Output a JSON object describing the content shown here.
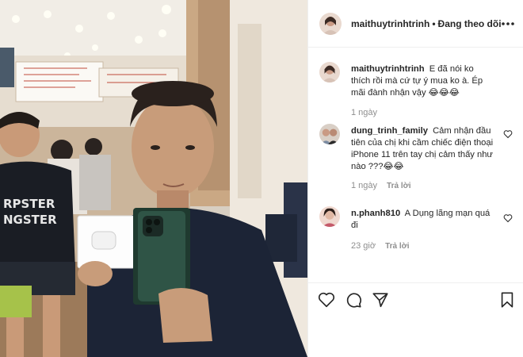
{
  "post": {
    "author": "maithuytrinhtrinh",
    "separator": "•",
    "follow_status": "Đang theo dõi"
  },
  "comments": [
    {
      "username": "maithuytrinhtrinh",
      "text": "E đã nói ko thích rồi mà cứ tự ý mua ko à. Ép mãi đành nhận vậy 😂😂😂",
      "time": "1 ngày",
      "reply_label": ""
    },
    {
      "username": "dung_trinh_family",
      "text": "Cảm nhận đầu tiên của chị khi cầm chiếc điện thoại iPhone 11 trên tay chị cảm thấy như nào ???😂😂",
      "time": "1 ngày",
      "reply_label": "Trả lời"
    },
    {
      "username": "n.phanh810",
      "text": "A Dụng lãng mạn quá đi",
      "time": "23 giờ",
      "reply_label": "Trả lời"
    }
  ],
  "icons": {
    "more": "more-options-icon",
    "like": "heart-icon",
    "comment": "comment-icon",
    "share": "share-icon",
    "save": "bookmark-icon"
  },
  "colors": {
    "text": "#262626",
    "muted": "#8e8e8e",
    "border": "#efefef"
  }
}
